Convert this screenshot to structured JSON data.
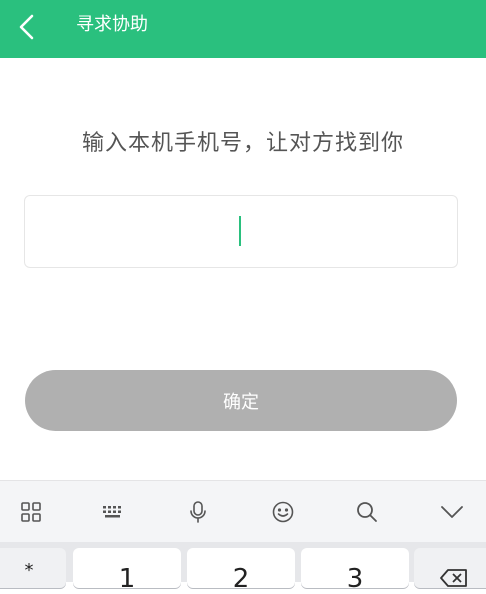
{
  "header": {
    "title": "寻求协助",
    "back_icon": "chevron-left-icon",
    "background": "#2ac07e"
  },
  "main": {
    "prompt": "输入本机手机号，让对方找到你",
    "phone_input": {
      "value": "",
      "placeholder": ""
    },
    "confirm_label": "确定",
    "confirm_color": "#b0b0b0"
  },
  "keyboard": {
    "toolbar_icons": [
      "grid-icon",
      "keyboard-icon",
      "microphone-icon",
      "emoji-icon",
      "search-icon",
      "chevron-down-icon"
    ],
    "keys": {
      "star": "*",
      "one": "1",
      "two": "2",
      "three": "3"
    },
    "delete_icon": "backspace-icon"
  }
}
